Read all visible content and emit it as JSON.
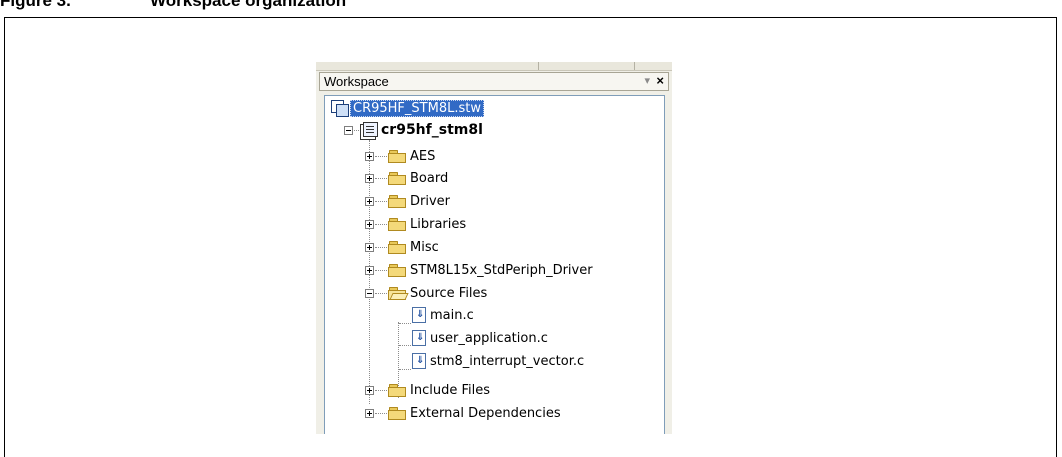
{
  "figure": {
    "number": "Figure 3.",
    "title": "Workspace organization"
  },
  "panel": {
    "title": "Workspace",
    "pin_glyph": "▾",
    "close_glyph": "×"
  },
  "tree": {
    "workspace_file": "CR95HF_STM8L.stw",
    "project": "cr95hf_stm8l",
    "folders": [
      {
        "label": "AES",
        "expanded": false
      },
      {
        "label": "Board",
        "expanded": false
      },
      {
        "label": "Driver",
        "expanded": false
      },
      {
        "label": "Libraries",
        "expanded": false
      },
      {
        "label": "Misc",
        "expanded": false
      },
      {
        "label": "STM8L15x_StdPeriph_Driver",
        "expanded": false
      },
      {
        "label": "Source Files",
        "expanded": true
      },
      {
        "label": "Include Files",
        "expanded": false
      },
      {
        "label": "External Dependencies",
        "expanded": false
      }
    ],
    "source_files": [
      "main.c",
      "user_application.c",
      "stm8_interrupt_vector.c"
    ]
  },
  "colors": {
    "selection": "#316ac5",
    "folder": "#f4d97a",
    "panel_bg": "#f0efe7"
  },
  "icons": {
    "workspace": "workspace-icon",
    "project": "project-icon",
    "folder": "folder-icon",
    "open_folder": "open-folder-icon",
    "file": "source-file-icon"
  }
}
